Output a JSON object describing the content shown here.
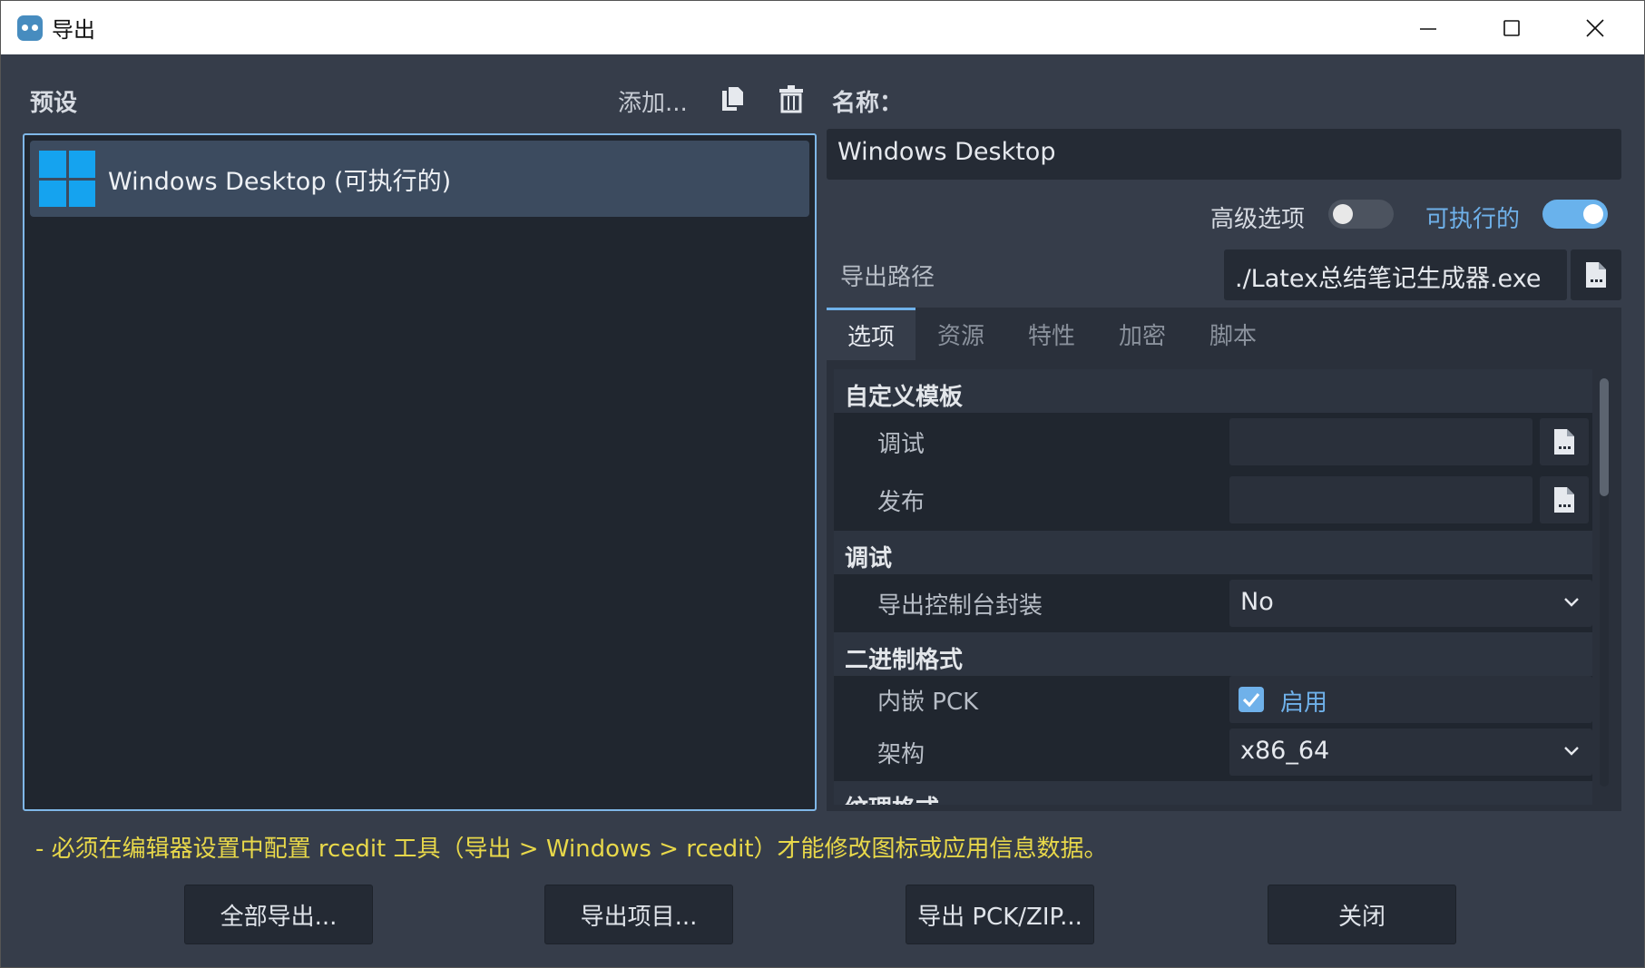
{
  "window": {
    "title": "导出",
    "controls": {
      "minimize": "–",
      "maximize": "☐",
      "close": "✕"
    }
  },
  "presets": {
    "label": "预设",
    "add_label": "添加...",
    "items": [
      {
        "label": "Windows Desktop (可执行的)"
      }
    ]
  },
  "details": {
    "name_label": "名称：",
    "name_value": "Windows Desktop",
    "advanced_label": "高级选项",
    "advanced_on": false,
    "executable_label": "可执行的",
    "executable_on": true,
    "export_path_label": "导出路径",
    "export_path_value": "./Latex总结笔记生成器.exe",
    "tabs": [
      "选项",
      "资源",
      "特性",
      "加密",
      "脚本"
    ],
    "active_tab": "选项",
    "sections": {
      "custom_template": "自定义模板",
      "debug_label": "调试",
      "release_label": "发布",
      "debug_section": "调试",
      "console_wrapper_label": "导出控制台封装",
      "console_wrapper_value": "No",
      "binary_format": "二进制格式",
      "embed_pck_label": "内嵌 PCK",
      "embed_pck_value": "启用",
      "embed_pck_checked": true,
      "arch_label": "架构",
      "arch_value": "x86_64",
      "texture_format": "纹理格式"
    }
  },
  "warning": "- 必须在编辑器设置中配置 rcedit 工具（导出 > Windows > rcedit）才能修改图标或应用信息数据。",
  "buttons": {
    "export_all": "全部导出...",
    "export_project": "导出项目...",
    "export_pck": "导出 PCK/ZIP...",
    "close": "关闭"
  },
  "colors": {
    "accent": "#6fb1ea",
    "warning": "#e8d84a",
    "windows_logo": "#15a3ef"
  }
}
